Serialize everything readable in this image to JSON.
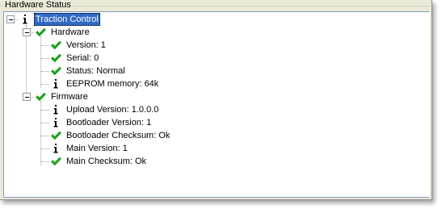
{
  "panel": {
    "title": "Hardware Status"
  },
  "tree": {
    "root": {
      "label": "Traction Control",
      "icon": "info-icon",
      "expanded": true,
      "selected": true
    },
    "hardware": {
      "label": "Hardware",
      "icon": "check-icon",
      "expanded": true,
      "items": [
        {
          "label": "Version: 1",
          "icon": "check-icon"
        },
        {
          "label": "Serial: 0",
          "icon": "check-icon"
        },
        {
          "label": "Status: Normal",
          "icon": "check-icon"
        },
        {
          "label": "EEPROM memory: 64k",
          "icon": "info-icon"
        }
      ]
    },
    "firmware": {
      "label": "Firmware",
      "icon": "check-icon",
      "expanded": true,
      "items": [
        {
          "label": "Upload Version: 1.0.0.0",
          "icon": "info-icon"
        },
        {
          "label": "Bootloader Version: 1",
          "icon": "info-icon"
        },
        {
          "label": "Bootloader Checksum: Ok",
          "icon": "check-icon"
        },
        {
          "label": "Main Version: 1",
          "icon": "info-icon"
        },
        {
          "label": "Main Checksum: Ok",
          "icon": "check-icon"
        }
      ]
    }
  },
  "colors": {
    "check": "#1aa31a",
    "info": "#000000",
    "selection": "#316ac5",
    "panel_bg": "#ece9d8",
    "tree_border": "#7f9db9"
  }
}
